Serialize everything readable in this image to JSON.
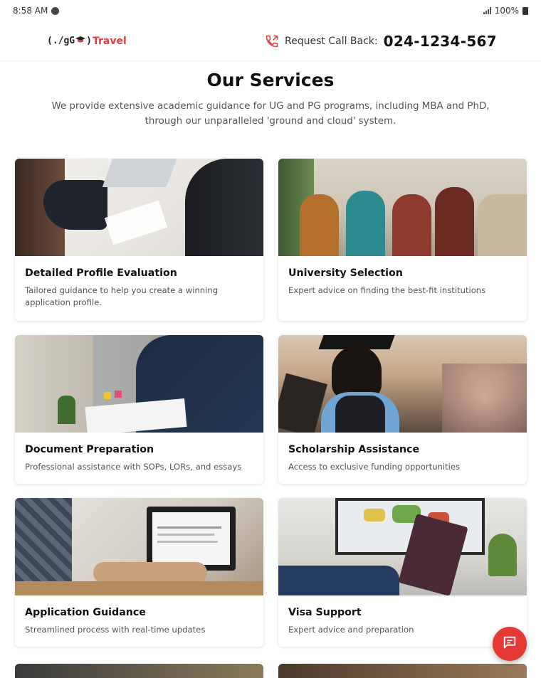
{
  "status_bar": {
    "time": "8:58 AM",
    "battery": "100%"
  },
  "header": {
    "logo_prefix": "(./gG",
    "logo_suffix": ")",
    "logo_brand": "Travel",
    "callback_label": "Request Call Back:",
    "callback_phone": "024-1234-567"
  },
  "intro": {
    "title": "Our Services",
    "description": "We provide extensive academic guidance for UG and PG programs, including MBA and PhD, through our unparalleled 'ground and cloud' system."
  },
  "services": [
    {
      "title": "Detailed Profile Evaluation",
      "description": "Tailored guidance to help you create a winning application profile."
    },
    {
      "title": "University Selection",
      "description": "Expert advice on finding the best-fit institutions"
    },
    {
      "title": "Document Preparation",
      "description": "Professional assistance with SOPs, LORs, and essays"
    },
    {
      "title": "Scholarship Assistance",
      "description": "Access to exclusive funding opportunities"
    },
    {
      "title": "Application Guidance",
      "description": "Streamlined process with real-time updates"
    },
    {
      "title": "Visa Support",
      "description": "Expert advice and preparation"
    }
  ],
  "colors": {
    "accent": "#e53935",
    "brand": "#e63b3b"
  },
  "icons": {
    "callback": "phone-callback-icon",
    "chat": "chat-icon"
  }
}
